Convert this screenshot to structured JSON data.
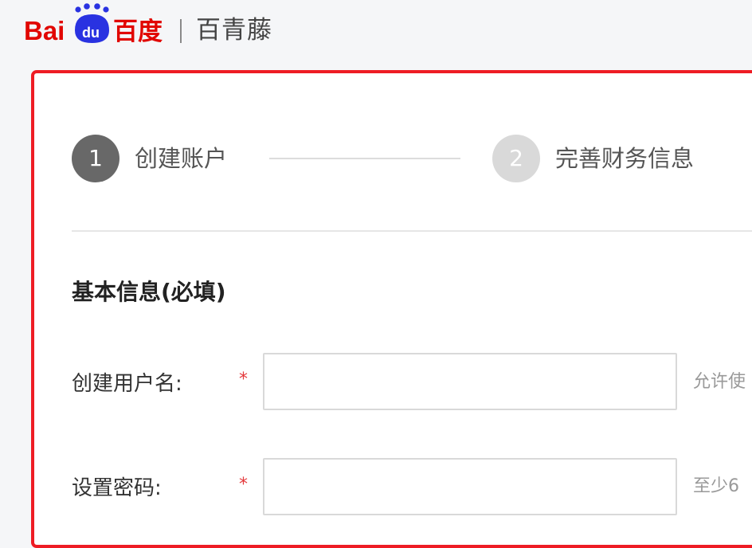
{
  "header": {
    "logo_alt": "Baidu百度",
    "product_name": "百青藤"
  },
  "steps": [
    {
      "number": "1",
      "label": "创建账户"
    },
    {
      "number": "2",
      "label": "完善财务信息"
    }
  ],
  "form": {
    "section_title": "基本信息(必填)",
    "fields": [
      {
        "label": "创建用户名:",
        "required_mark": "*",
        "value": "",
        "hint": "允许使"
      },
      {
        "label": "设置密码:",
        "required_mark": "*",
        "value": "",
        "hint": "至少6"
      }
    ]
  },
  "colors": {
    "brand_red": "#ee1c24",
    "baidu_blue": "#2932e1",
    "step_active": "#686868",
    "step_inactive": "#d9d9d9",
    "required_red": "#e4393c"
  }
}
